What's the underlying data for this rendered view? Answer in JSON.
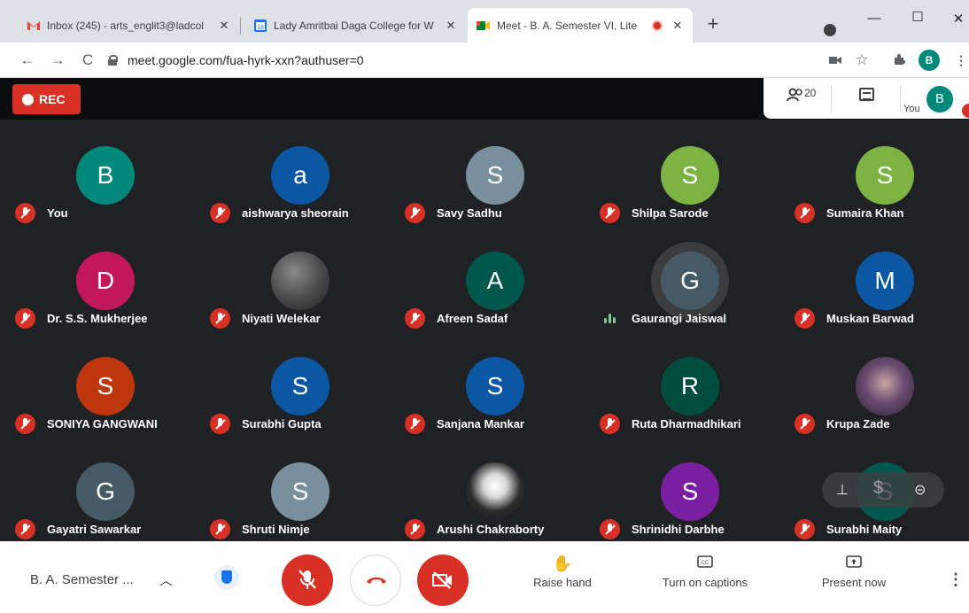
{
  "browser": {
    "tabs": [
      {
        "title": "Inbox (245) - arts_englit3@ladcol",
        "icon": "gmail-icon"
      },
      {
        "title": "Lady Amritbai Daga College for W",
        "icon": "calendar-icon",
        "icon_text": "18"
      },
      {
        "title": "Meet - B. A. Semester VI, Lite",
        "icon": "meet-icon",
        "active": true
      }
    ],
    "url": "meet.google.com/fua-hyrk-xxn?authuser=0",
    "profile_initial": "B"
  },
  "meet": {
    "rec_label": "REC",
    "people_count": "20",
    "you_label": "You",
    "you_initial": "B",
    "participants": [
      {
        "name": "You",
        "initial": "B",
        "color": "#00897b",
        "status": "muted"
      },
      {
        "name": "aishwarya sheorain",
        "initial": "a",
        "color": "#0b57a4",
        "status": "muted"
      },
      {
        "name": "Savy Sadhu",
        "initial": "S",
        "color": "#78909c",
        "status": "muted"
      },
      {
        "name": "Shilpa Sarode",
        "initial": "S",
        "color": "#7cb342",
        "status": "muted"
      },
      {
        "name": "Sumaira Khan",
        "initial": "S",
        "color": "#7cb342",
        "status": "muted"
      },
      {
        "name": "Dr. S.S. Mukherjee",
        "initial": "D",
        "color": "#c2185b",
        "status": "muted"
      },
      {
        "name": "Niyati Welekar",
        "initial": "",
        "color": "photo",
        "status": "muted"
      },
      {
        "name": "Afreen Sadaf",
        "initial": "A",
        "color": "#00574b",
        "status": "muted"
      },
      {
        "name": "Gaurangi Jaiswal",
        "initial": "G",
        "color": "#455a64",
        "status": "speaking"
      },
      {
        "name": "Muskan Barwad",
        "initial": "M",
        "color": "#0b57a4",
        "status": "muted"
      },
      {
        "name": "SONIYA GANGWANI",
        "initial": "S",
        "color": "#bf360c",
        "status": "muted"
      },
      {
        "name": "Surabhi Gupta",
        "initial": "S",
        "color": "#0b57a4",
        "status": "muted"
      },
      {
        "name": "Sanjana Mankar",
        "initial": "S",
        "color": "#0b57a4",
        "status": "muted"
      },
      {
        "name": "Ruta Dharmadhikari",
        "initial": "R",
        "color": "#004d40",
        "status": "muted"
      },
      {
        "name": "Krupa Zade",
        "initial": "",
        "color": "photo2",
        "status": "muted"
      },
      {
        "name": "Gayatri Sawarkar",
        "initial": "G",
        "color": "#455a64",
        "status": "muted"
      },
      {
        "name": "Shruti Nimje",
        "initial": "S",
        "color": "#78909c",
        "status": "muted"
      },
      {
        "name": "Arushi Chakraborty",
        "initial": "",
        "color": "photo3",
        "status": "muted"
      },
      {
        "name": "Shrinidhi Darbhe",
        "initial": "S",
        "color": "#7b1fa2",
        "status": "muted"
      },
      {
        "name": "Surabhi Maity",
        "initial": "S",
        "color": "#00574b",
        "status": "muted"
      }
    ]
  },
  "controls": {
    "meeting_title": "B. A. Semester ...",
    "raise_hand_label": "Raise hand",
    "captions_label": "Turn on captions",
    "present_label": "Present now"
  }
}
